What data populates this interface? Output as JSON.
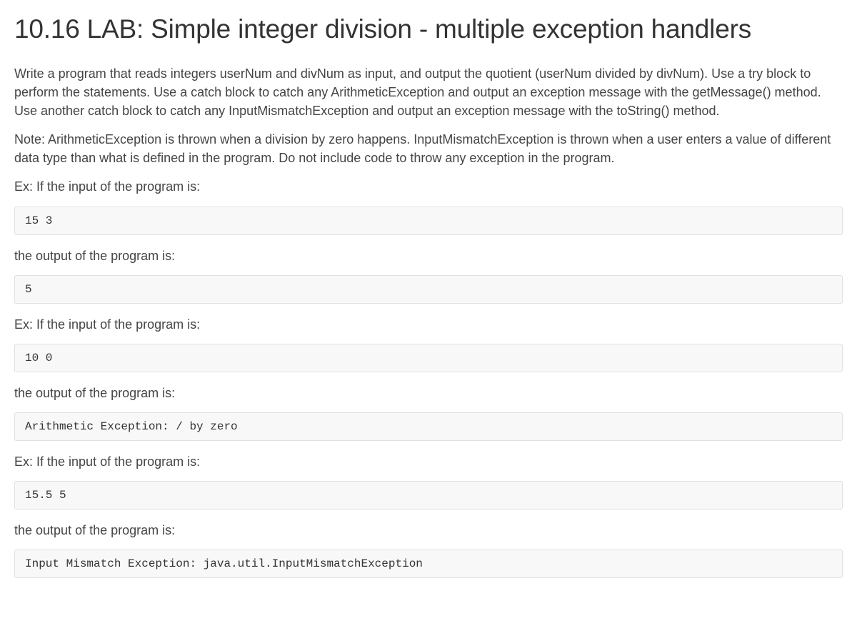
{
  "title": "10.16 LAB: Simple integer division - multiple exception handlers",
  "paragraphs": {
    "intro": "Write a program that reads integers userNum and divNum as input, and output the quotient (userNum divided by divNum). Use a try block to perform the statements. Use a catch block to catch any ArithmeticException and output an exception message with the getMessage() method. Use another catch block to catch any InputMismatchException and output an exception message with the toString() method.",
    "note": "Note: ArithmeticException is thrown when a division by zero happens. InputMismatchException is thrown when a user enters a value of different data type than what is defined in the program. Do not include code to throw any exception in the program.",
    "ex_input": "Ex: If the input of the program is:",
    "the_output": "the output of the program is:"
  },
  "codes": {
    "in1": "15 3",
    "out1": "5",
    "in2": "10 0",
    "out2": "Arithmetic Exception: / by zero",
    "in3": "15.5 5",
    "out3": "Input Mismatch Exception: java.util.InputMismatchException"
  }
}
